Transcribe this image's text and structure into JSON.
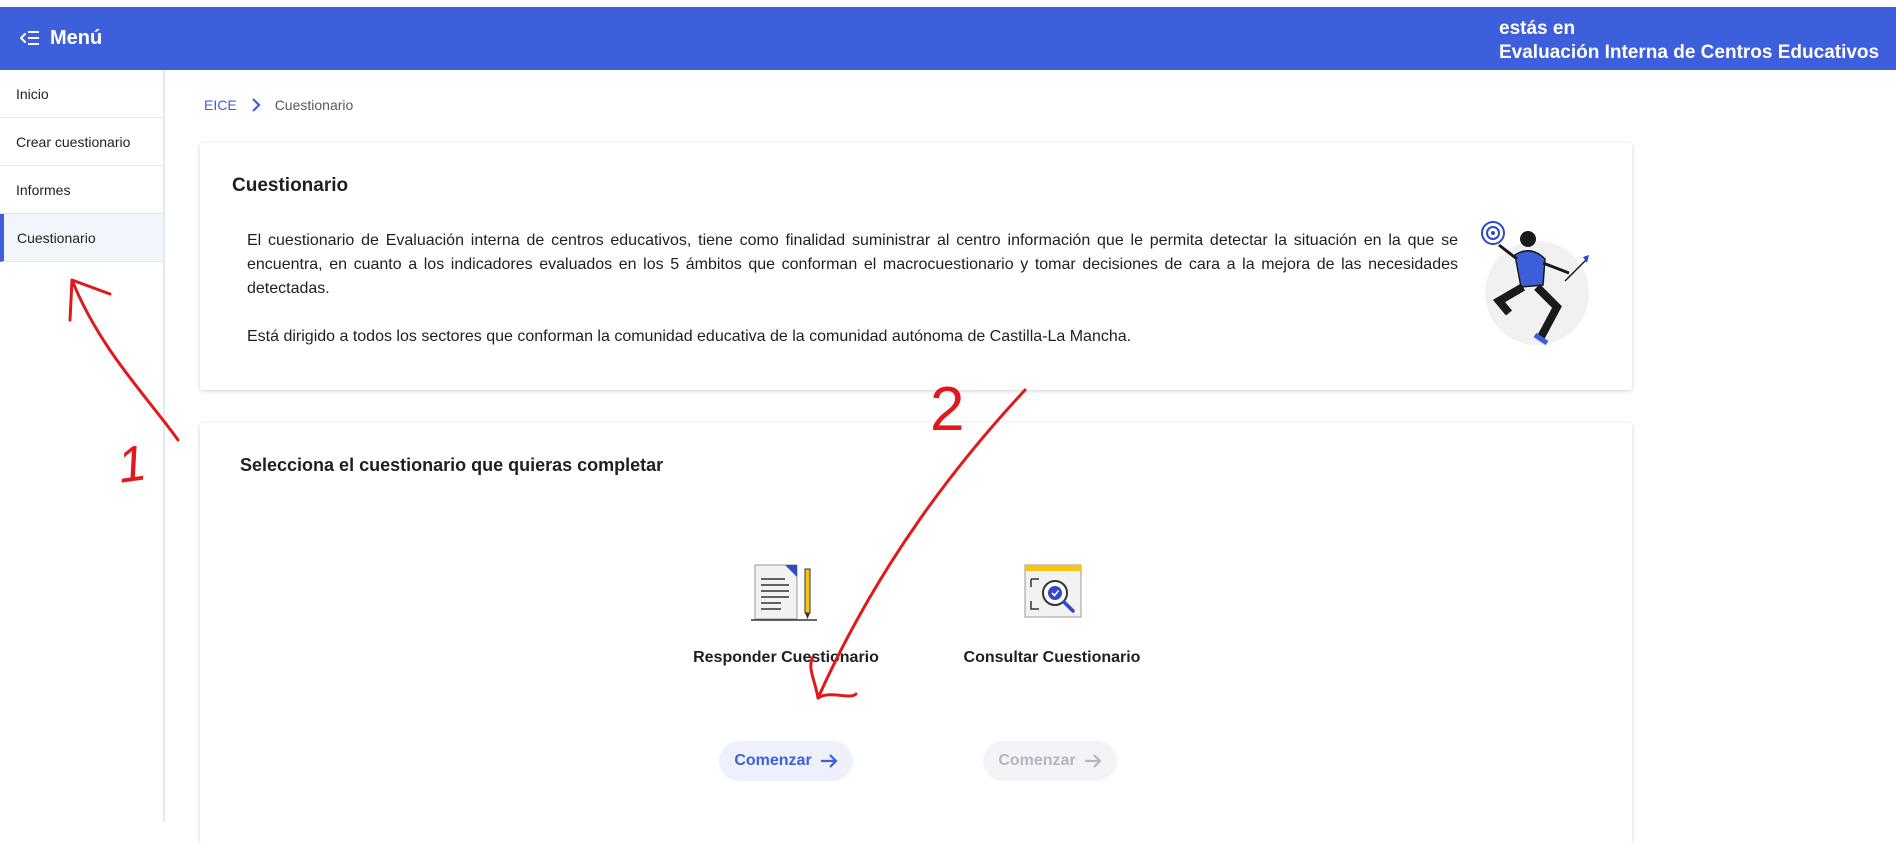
{
  "header": {
    "menu_label": "Menú",
    "location_prefix": "estás en",
    "app_name": "Evaluación Interna de Centros Educativos",
    "color": "#3d5fdc"
  },
  "sidebar": {
    "items": [
      {
        "label": "Inicio"
      },
      {
        "label": "Crear cuestionario"
      },
      {
        "label": "Informes"
      },
      {
        "label": "Cuestionario",
        "active": true
      }
    ]
  },
  "breadcrumb": {
    "root": "EICE",
    "current": "Cuestionario"
  },
  "intro": {
    "title": "Cuestionario",
    "paragraph1": "El cuestionario de Evaluación interna de centros educativos, tiene como finalidad suministrar al centro información que le permita detectar la situación en la que se encuentra, en cuanto a los indicadores evaluados en los 5 ámbitos que conforman el macrocuestionario y tomar decisiones de cara a la mejora de las necesidades detectadas.",
    "paragraph2": "Está dirigido a todos los sectores que conforman la comunidad educativa de la comunidad autónoma de Castilla-La Mancha."
  },
  "selection": {
    "title": "Selecciona el cuestionario que quieras completar",
    "options": [
      {
        "title": "Responder Cuestionario",
        "icon": "document-pencil-icon",
        "button": "Comenzar",
        "enabled": true
      },
      {
        "title": "Consultar Cuestionario",
        "icon": "search-document-icon",
        "button": "Comenzar",
        "enabled": false
      }
    ]
  },
  "annotations": {
    "label1": "1",
    "label2": "2",
    "color": "#e0191c"
  }
}
